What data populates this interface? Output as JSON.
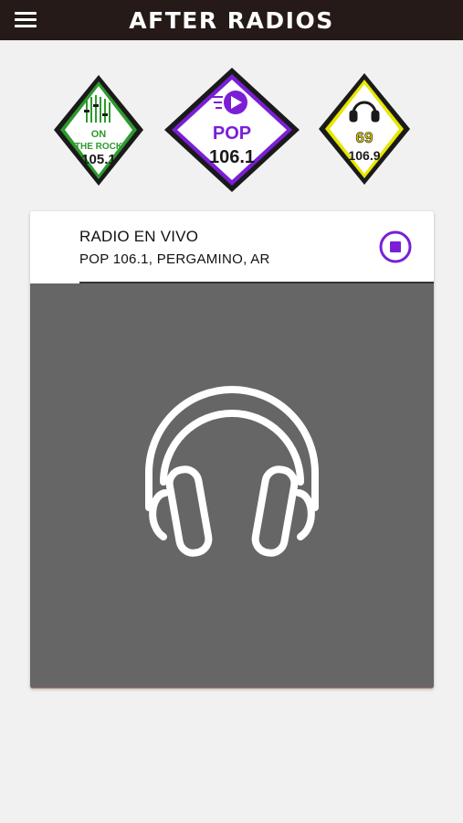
{
  "app": {
    "title": "AFTER RADIOS"
  },
  "stations": [
    {
      "lines": [
        "ON",
        "THE ROCK",
        "105.1"
      ],
      "color": "#2e9a2e",
      "icon": "equalizer-icon"
    },
    {
      "lines": [
        "POP",
        "106.1"
      ],
      "color": "#7a1fd6",
      "icon": "play-icon",
      "selected": true
    },
    {
      "lines": [
        "69",
        "106.9"
      ],
      "color": "#e6e600",
      "icon": "headphones-icon"
    }
  ],
  "player": {
    "title": "RADIO EN VIVO",
    "subtitle": "POP 106.1, PERGAMINO, AR",
    "stop_icon": "stop-icon",
    "artwork_icon": "headphones-icon",
    "accent": "#7a1fd6",
    "artwork_bg": "#666666"
  }
}
